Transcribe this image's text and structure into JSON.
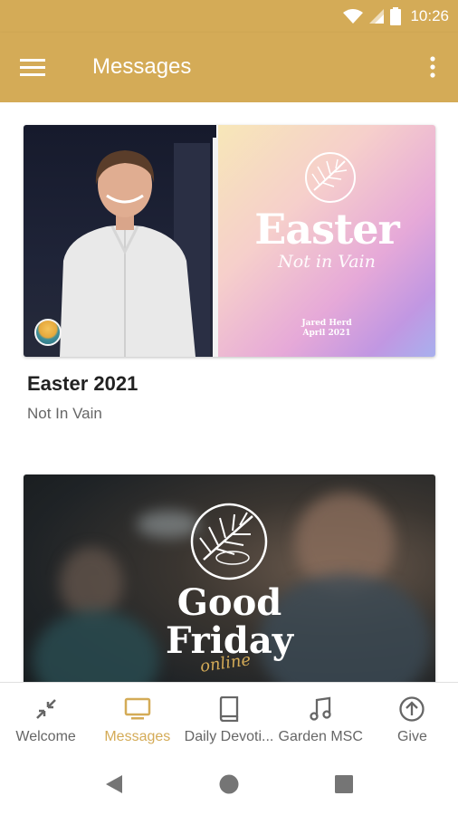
{
  "status_bar": {
    "time": "10:26"
  },
  "app_bar": {
    "title": "Messages"
  },
  "messages": [
    {
      "title": "Easter 2021",
      "subtitle": "Not In Vain",
      "thumbnail": {
        "headline": "Easter",
        "script": "Not in Vain",
        "credit_line_1": "Jared Herd",
        "credit_line_2": "April 2021"
      }
    },
    {
      "thumbnail": {
        "headline_line_1": "Good",
        "headline_line_2": "Friday",
        "script": "online"
      }
    }
  ],
  "bottom_nav": [
    {
      "label": "Welcome",
      "icon": "collapse-arrows-icon",
      "active": false
    },
    {
      "label": "Messages",
      "icon": "tv-icon",
      "active": true
    },
    {
      "label": "Daily Devoti...",
      "icon": "book-icon",
      "active": false
    },
    {
      "label": "Garden MSC",
      "icon": "music-note-icon",
      "active": false
    },
    {
      "label": "Give",
      "icon": "arrow-up-circle-icon",
      "active": false
    }
  ],
  "colors": {
    "accent": "#d4ab57",
    "inactive": "#666666"
  }
}
